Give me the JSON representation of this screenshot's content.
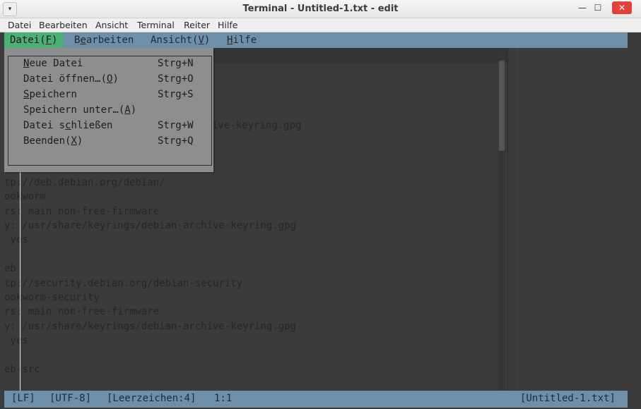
{
  "window": {
    "title": "Terminal - Untitled-1.txt - edit",
    "controls": {
      "minimize": "—",
      "maximize": "☐",
      "close": "✕"
    },
    "menu_glyph": "▾"
  },
  "app_menu": [
    "Datei",
    "Bearbeiten",
    "Ansicht",
    "Terminal",
    "Reiter",
    "Hilfe"
  ],
  "edit_menubar": {
    "datei": {
      "pre": "Datei(",
      "key": "F",
      "post": ")"
    },
    "bearbeiten": {
      "pre": "B",
      "key": "e",
      "post": "arbeiten"
    },
    "ansicht": {
      "pre": "Ansicht(",
      "key": "V",
      "post": ")"
    },
    "hilfe": {
      "pre": "",
      "key": "H",
      "post": "ilfe"
    }
  },
  "file_menu": [
    {
      "pre": "",
      "key": "N",
      "post": "eue Datei",
      "shortcut": "Strg+N"
    },
    {
      "pre": "Datei öffnen…(",
      "key": "O",
      "post": ")",
      "shortcut": "Strg+O"
    },
    {
      "pre": "",
      "key": "S",
      "post": "peichern",
      "shortcut": "Strg+S"
    },
    {
      "pre": "Speichern unter…(",
      "key": "A",
      "post": ")",
      "shortcut": ""
    },
    {
      "pre": "Datei s",
      "key": "c",
      "post": "hließen",
      "shortcut": "Strg+W"
    },
    {
      "pre": "Beenden(",
      "key": "X",
      "post": ")",
      "shortcut": "Strg+Q"
    }
  ],
  "editor_lines": [
    "tp://deb.debian.org/debian/",
    "ookworm",
    "rs: main non-free-firmware",
    "y: /usr/share/keyrings/debian-archive-keyring.gpg",
    " yes",
    "",
    "eb",
    "tp://security.debian.org/debian-security",
    "ookworm-security",
    "rs: main non-free-firmware",
    "y: /usr/share/keyrings/debian-archive-keyring.gpg",
    " yes",
    "",
    "eb-src"
  ],
  "partial_line": "ive-keyring.gpg",
  "status": {
    "line_ending": "[LF]",
    "encoding": "[UTF-8]",
    "indent": "[Leerzeichen:4]",
    "position": "1:1",
    "filename": "[Untitled-1.txt]"
  }
}
